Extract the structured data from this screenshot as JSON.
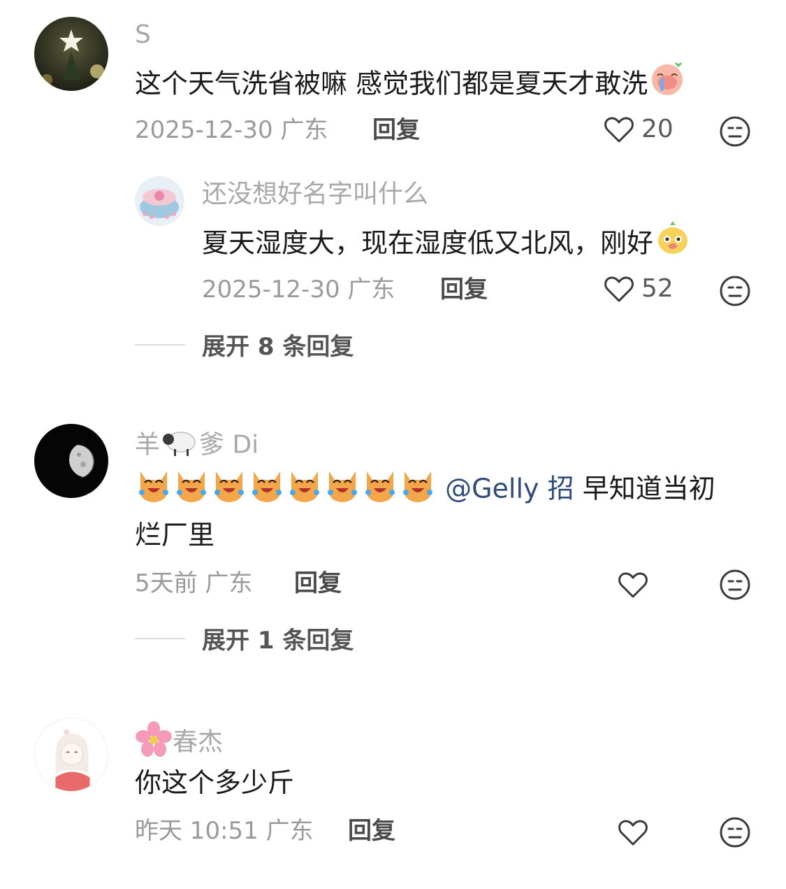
{
  "comments": [
    {
      "username": "S",
      "text": "这个天气洗省被嘛 感觉我们都是夏天才敢洗",
      "time": "2025-12-30",
      "location": "广东",
      "reply_label": "回复",
      "likes": "20",
      "replies": [
        {
          "username": "还没想好名字叫什么",
          "text": "夏天湿度大，现在湿度低又北风，刚好",
          "time": "2025-12-30",
          "location": "广东",
          "reply_label": "回复",
          "likes": "52"
        }
      ],
      "expand_label": "展开 8 条回复"
    },
    {
      "username_prefix": "羊",
      "username_suffix": "爹 Di",
      "text_mention": "@Gelly 招",
      "text_rest": " 早知道当初",
      "text_line2": "烂厂里",
      "time": "5天前",
      "location": "广东",
      "reply_label": "回复",
      "expand_label": "展开 1 条回复"
    },
    {
      "username": "春杰",
      "text": "你这个多少斤",
      "time": "昨天 10:51",
      "location": "广东",
      "reply_label": "回复"
    }
  ],
  "icons": {
    "like": "heart-outline-icon",
    "dislike": "neutral-face-icon"
  }
}
